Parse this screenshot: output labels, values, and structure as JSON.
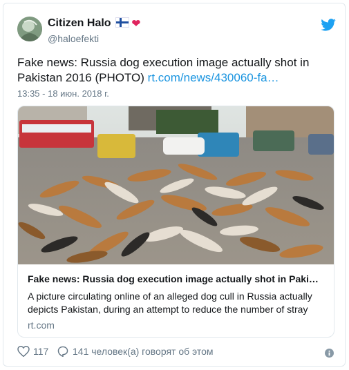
{
  "author": {
    "name": "Citizen Halo",
    "handle": "@haloefekti"
  },
  "tweet": {
    "text": "Fake news: Russia dog execution image actually shot in Pakistan 2016 (PHOTO)",
    "link": "rt.com/news/430060-fa…",
    "timestamp": "13:35 - 18 июн. 2018 г."
  },
  "card": {
    "title": "Fake news: Russia dog execution image actually shot in Paki…",
    "description": "A picture circulating online of an alleged dog cull in Russia actually depicts Pakistan, during an attempt to reduce the number of stray",
    "domain": "rt.com"
  },
  "actions": {
    "likes": "117",
    "conversation": "141 человек(а) говорят об этом"
  },
  "colors": {
    "link": "#1b95e0",
    "muted": "#657786",
    "border": "#e1e8ed",
    "like_red": "#e0245e"
  },
  "icons": [
    "twitter-bird-icon",
    "finland-flag-icon",
    "red-bird-emoji-icon",
    "heart-icon",
    "reply-bubble-icon",
    "info-icon"
  ]
}
